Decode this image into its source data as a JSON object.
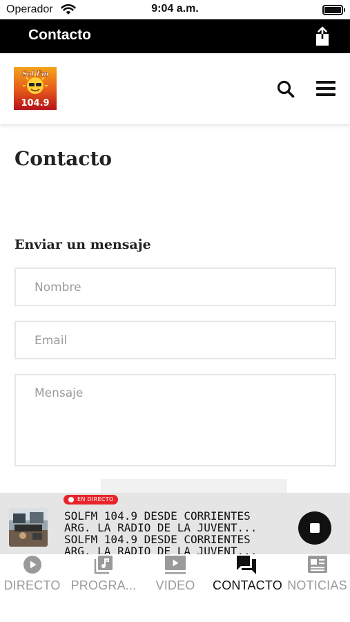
{
  "status_bar": {
    "carrier": "Operador",
    "time": "9:04 a.m."
  },
  "nav_bar": {
    "title": "Contacto"
  },
  "header": {
    "logo_top": "Sol Fm",
    "logo_freq": "104.9"
  },
  "page": {
    "title": "Contacto"
  },
  "form": {
    "title": "Enviar un mensaje",
    "name_placeholder": "Nombre",
    "email_placeholder": "Email",
    "message_placeholder": "Mensaje"
  },
  "player": {
    "live_label": "EN DIRECTO",
    "line1": "SOLFM 104.9 DESDE CORRIENTES",
    "line2": "ARG. LA RADIO DE LA JUVENT...",
    "line3": "SOLFM 104.9 DESDE CORRIENTES",
    "line4": "ARG. LA RADIO DE LA JUVENT..."
  },
  "tabs": [
    {
      "label": "DIRECTO",
      "icon": "play-circle-icon",
      "active": false
    },
    {
      "label": "PROGRA...",
      "icon": "music-library-icon",
      "active": false
    },
    {
      "label": "VIDEO",
      "icon": "video-icon",
      "active": false
    },
    {
      "label": "CONTACTO",
      "icon": "chat-bubbles-icon",
      "active": true
    },
    {
      "label": "NOTICIAS",
      "icon": "newspaper-icon",
      "active": false
    }
  ],
  "colors": {
    "nav_background": "#000000",
    "live_badge": "#e8242a",
    "tab_active": "#111111",
    "tab_inactive": "#9a9a9a"
  }
}
